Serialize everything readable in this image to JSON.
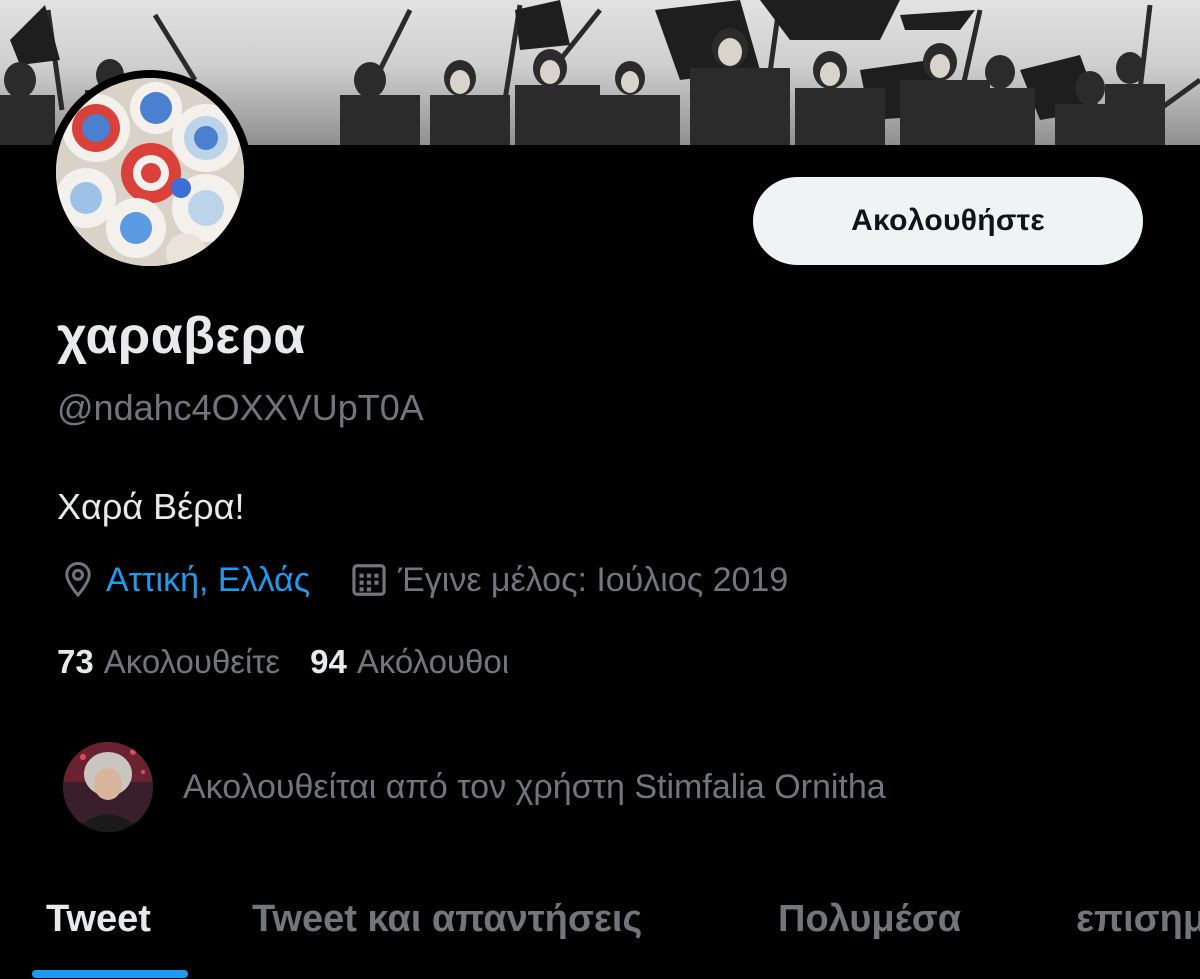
{
  "profile": {
    "display_name": "χαραβερα",
    "handle": "@ndahc4OXXVUpT0A",
    "bio": "Χαρά Βέρα!",
    "location": "Αττική, Ελλάς",
    "joined": "Έγινε μέλος: Ιούλιος 2019",
    "following_count": "73",
    "following_label": "Ακολουθείτε",
    "followers_count": "94",
    "followers_label": "Ακόλουθοι",
    "followed_by": "Ακολουθείται από τον χρήστη Stimfalia Ornitha"
  },
  "actions": {
    "follow_label": "Ακολουθήστε"
  },
  "tabs": [
    {
      "label": "Tweet",
      "active": true
    },
    {
      "label": "Tweet και απαντήσεις",
      "active": false
    },
    {
      "label": "Πολυμέσα",
      "active": false
    },
    {
      "label": "επισημάνσεις",
      "active": false
    }
  ],
  "icons": {
    "location": "location-pin-icon",
    "joined": "calendar-icon"
  },
  "colors": {
    "accent": "#1d9bf0",
    "background": "#000000",
    "secondary_text": "#71767b",
    "primary_text": "#e7e9ea",
    "follow_button_bg": "#eff3f4"
  }
}
